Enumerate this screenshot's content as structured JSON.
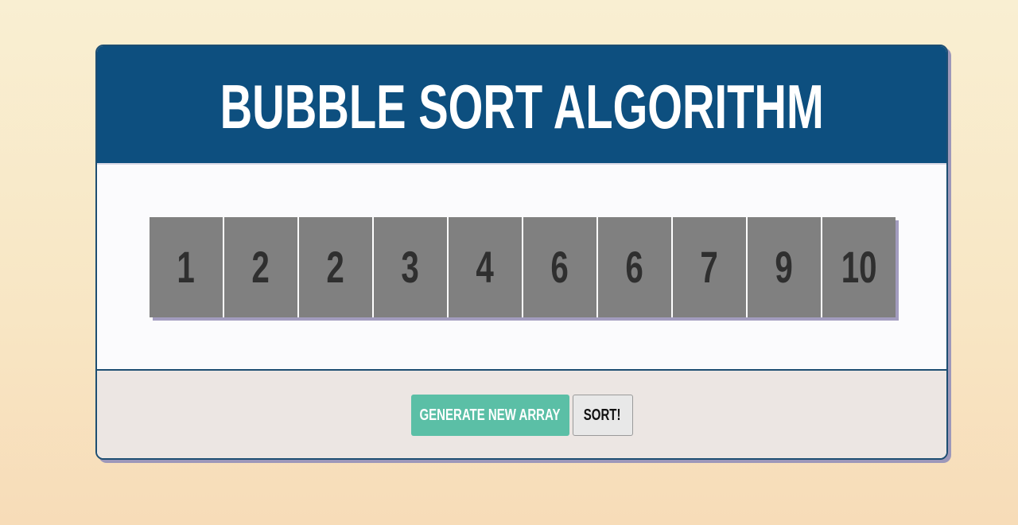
{
  "header": {
    "title": "BUBBLE SORT ALGORITHM"
  },
  "array": {
    "values": [
      "1",
      "2",
      "2",
      "3",
      "4",
      "6",
      "6",
      "7",
      "9",
      "10"
    ]
  },
  "controls": {
    "generate_label": "GENERATE NEW ARRAY",
    "sort_label": "SORT!"
  },
  "colors": {
    "header_bg": "#0d4f7f",
    "bar_bg": "#808080",
    "generate_bg": "#5bbfa6",
    "footer_bg": "#ece6e3"
  }
}
